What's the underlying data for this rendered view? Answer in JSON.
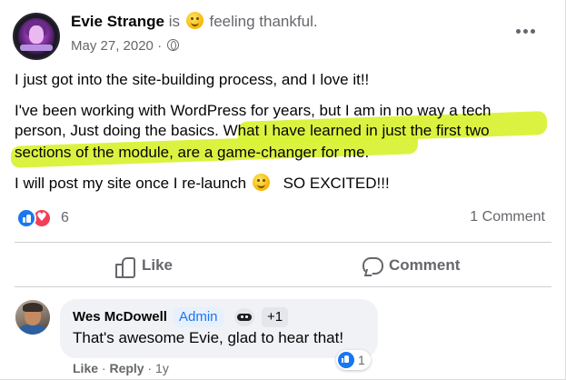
{
  "post": {
    "author_name": "Evie Strange",
    "author_is": "is",
    "feeling": "feeling thankful.",
    "date": "May 27, 2020",
    "dot": "·",
    "paragraph1": "I just got into the site-building process, and I love it!!",
    "paragraph2_line1": "I've been working with WordPress for years, but I am in no way a tech",
    "paragraph2_line2": "person,  Just doing the basics.  What I have learned in just the first two",
    "paragraph2_line3": "sections of the module, are a game-changer for me.",
    "paragraph3_before": "I will post my site once I re-launch",
    "paragraph3_after": "SO EXCITED!!!",
    "highlight_color": "#d9f236"
  },
  "stats": {
    "reaction_count": "6",
    "comment_count": "1 Comment"
  },
  "actions": {
    "like_label": "Like",
    "comment_label": "Comment"
  },
  "comment": {
    "author_name": "Wes McDowell",
    "badge": "Admin",
    "extra_badges": "+1",
    "text": "That's awesome Evie, glad to hear that!",
    "reaction_count": "1",
    "like_label": "Like",
    "separator": "·",
    "reply_label": "Reply",
    "age": "1y"
  },
  "colors": {
    "accent": "#1877f2",
    "love": "#f33e58",
    "secondary_text": "#65676b",
    "comment_bg": "#f0f2f5"
  }
}
